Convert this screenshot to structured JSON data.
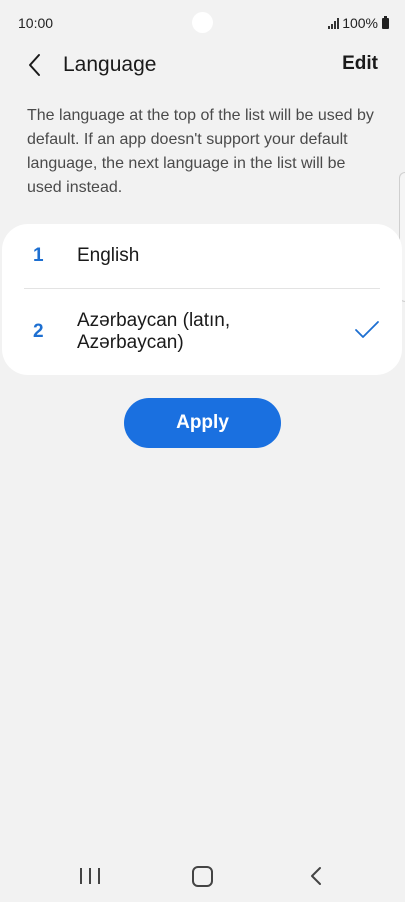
{
  "status_bar": {
    "time": "10:00",
    "battery": "100%"
  },
  "app_bar": {
    "title": "Language",
    "edit_label": "Edit"
  },
  "description": "The language at the top of the list will be used by default. If an app doesn't support your default language, the next language in the list will be used instead.",
  "languages": [
    {
      "number": "1",
      "name": "English",
      "selected": false
    },
    {
      "number": "2",
      "name": "Azərbaycan (latın, Azərbaycan)",
      "selected": true
    }
  ],
  "apply_label": "Apply",
  "colors": {
    "accent": "#1a70e0",
    "number": "#1d6fd1",
    "background": "#f2f2f2",
    "card": "#ffffff"
  },
  "icons": {
    "back": "chevron-left-icon",
    "check": "checkmark-icon",
    "signal": "signal-icon",
    "battery": "battery-icon",
    "nav_recent": "recent-apps-icon",
    "nav_home": "home-icon",
    "nav_back": "back-icon"
  }
}
